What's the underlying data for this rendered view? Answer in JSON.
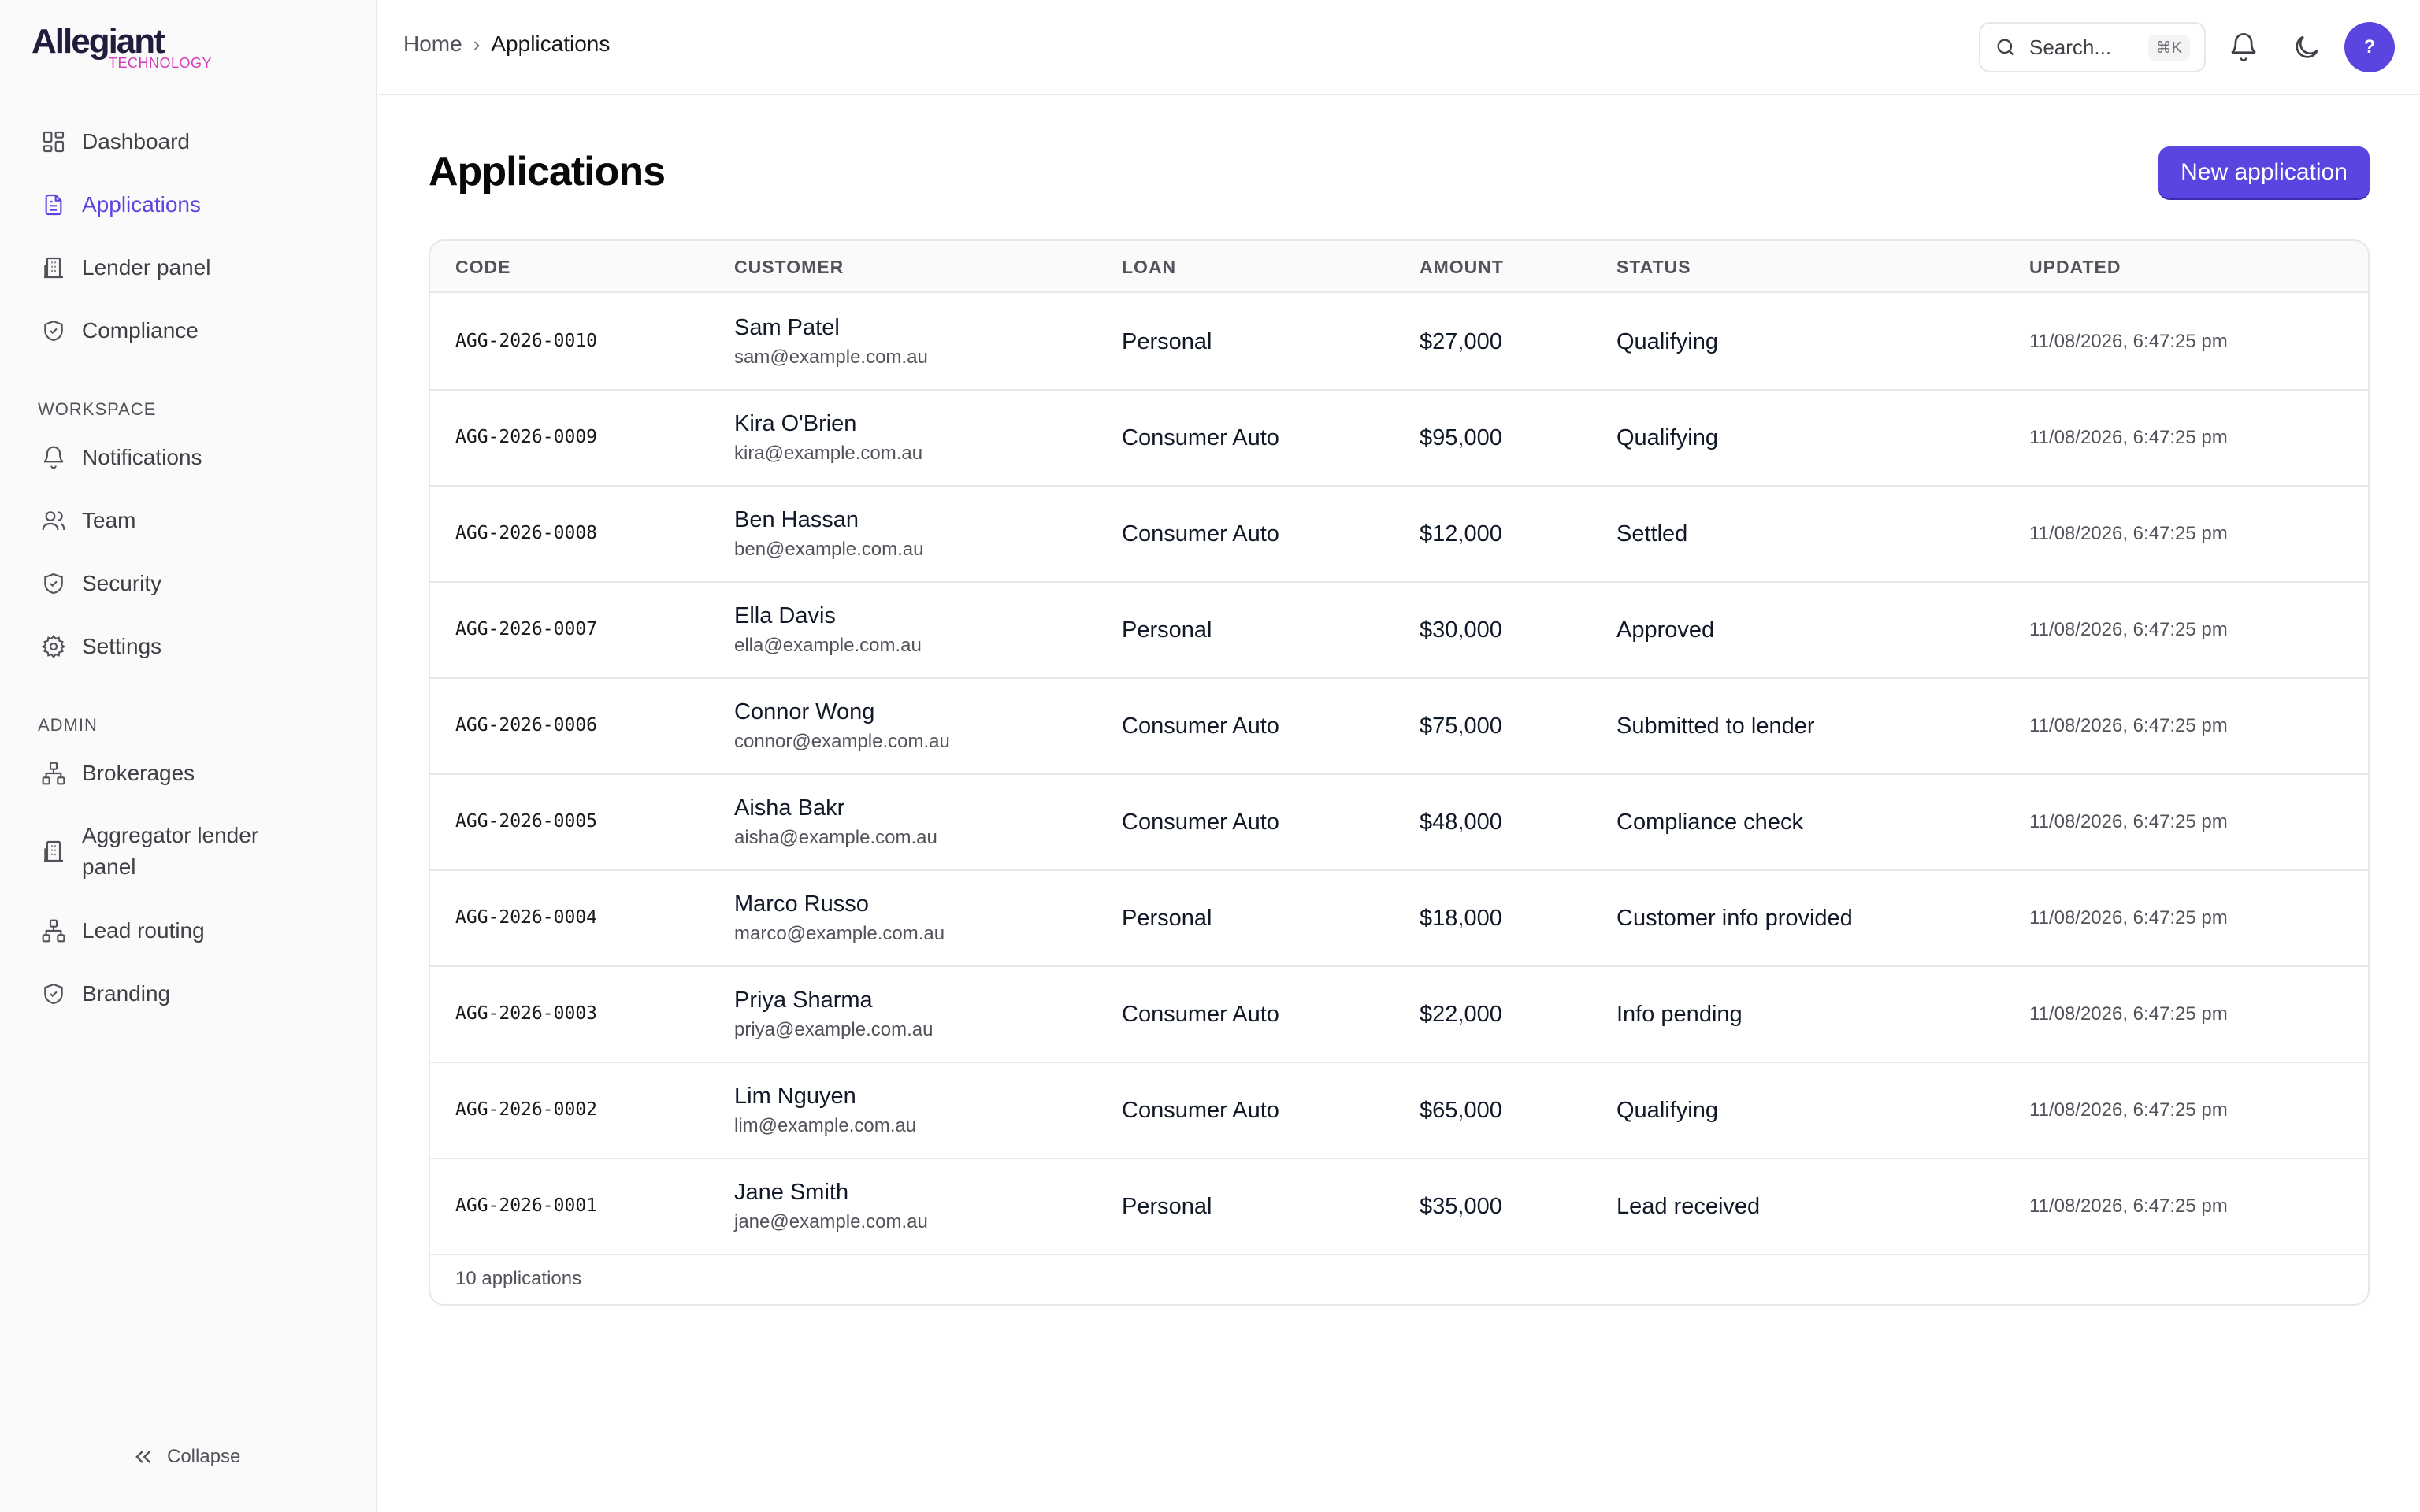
{
  "brand": {
    "name": "Allegiant",
    "sub": "TECHNOLOGY"
  },
  "sidebar": {
    "main_items": [
      {
        "label": "Dashboard",
        "icon": "dashboard-icon"
      },
      {
        "label": "Applications",
        "icon": "document-icon",
        "active": true
      },
      {
        "label": "Lender panel",
        "icon": "building-icon"
      },
      {
        "label": "Compliance",
        "icon": "shield-check-icon"
      }
    ],
    "workspace_label": "WORKSPACE",
    "workspace_items": [
      {
        "label": "Notifications",
        "icon": "bell-icon"
      },
      {
        "label": "Team",
        "icon": "users-icon"
      },
      {
        "label": "Security",
        "icon": "shield-check-icon"
      },
      {
        "label": "Settings",
        "icon": "gear-icon"
      }
    ],
    "admin_label": "ADMIN",
    "admin_items": [
      {
        "label": "Brokerages",
        "icon": "network-icon"
      },
      {
        "label": "Aggregator lender panel",
        "icon": "building-icon"
      },
      {
        "label": "Lead routing",
        "icon": "network-icon"
      },
      {
        "label": "Branding",
        "icon": "shield-check-icon"
      }
    ],
    "collapse_label": "Collapse"
  },
  "topbar": {
    "breadcrumb_home": "Home",
    "breadcrumb_current": "Applications",
    "search_placeholder": "Search...",
    "search_shortcut": "⌘K",
    "avatar_label": "?"
  },
  "page": {
    "title": "Applications",
    "new_button": "New application"
  },
  "table": {
    "headers": {
      "code": "CODE",
      "customer": "CUSTOMER",
      "loan": "LOAN",
      "amount": "AMOUNT",
      "status": "STATUS",
      "updated": "UPDATED"
    },
    "rows": [
      {
        "code": "AGG-2026-0010",
        "name": "Sam Patel",
        "email": "sam@example.com.au",
        "loan": "Personal",
        "amount": "$27,000",
        "status": "Qualifying",
        "updated": "11/08/2026, 6:47:25 pm"
      },
      {
        "code": "AGG-2026-0009",
        "name": "Kira O'Brien",
        "email": "kira@example.com.au",
        "loan": "Consumer Auto",
        "amount": "$95,000",
        "status": "Qualifying",
        "updated": "11/08/2026, 6:47:25 pm"
      },
      {
        "code": "AGG-2026-0008",
        "name": "Ben Hassan",
        "email": "ben@example.com.au",
        "loan": "Consumer Auto",
        "amount": "$12,000",
        "status": "Settled",
        "updated": "11/08/2026, 6:47:25 pm"
      },
      {
        "code": "AGG-2026-0007",
        "name": "Ella Davis",
        "email": "ella@example.com.au",
        "loan": "Personal",
        "amount": "$30,000",
        "status": "Approved",
        "updated": "11/08/2026, 6:47:25 pm"
      },
      {
        "code": "AGG-2026-0006",
        "name": "Connor Wong",
        "email": "connor@example.com.au",
        "loan": "Consumer Auto",
        "amount": "$75,000",
        "status": "Submitted to lender",
        "updated": "11/08/2026, 6:47:25 pm"
      },
      {
        "code": "AGG-2026-0005",
        "name": "Aisha Bakr",
        "email": "aisha@example.com.au",
        "loan": "Consumer Auto",
        "amount": "$48,000",
        "status": "Compliance check",
        "updated": "11/08/2026, 6:47:25 pm"
      },
      {
        "code": "AGG-2026-0004",
        "name": "Marco Russo",
        "email": "marco@example.com.au",
        "loan": "Personal",
        "amount": "$18,000",
        "status": "Customer info provided",
        "updated": "11/08/2026, 6:47:25 pm"
      },
      {
        "code": "AGG-2026-0003",
        "name": "Priya Sharma",
        "email": "priya@example.com.au",
        "loan": "Consumer Auto",
        "amount": "$22,000",
        "status": "Info pending",
        "updated": "11/08/2026, 6:47:25 pm"
      },
      {
        "code": "AGG-2026-0002",
        "name": "Lim Nguyen",
        "email": "lim@example.com.au",
        "loan": "Consumer Auto",
        "amount": "$65,000",
        "status": "Qualifying",
        "updated": "11/08/2026, 6:47:25 pm"
      },
      {
        "code": "AGG-2026-0001",
        "name": "Jane Smith",
        "email": "jane@example.com.au",
        "loan": "Personal",
        "amount": "$35,000",
        "status": "Lead received",
        "updated": "11/08/2026, 6:47:25 pm"
      }
    ],
    "footer": "10 applications"
  },
  "colors": {
    "accent": "#5b45e0",
    "brand_sub": "#d63ab8",
    "border": "#e5e7eb"
  }
}
